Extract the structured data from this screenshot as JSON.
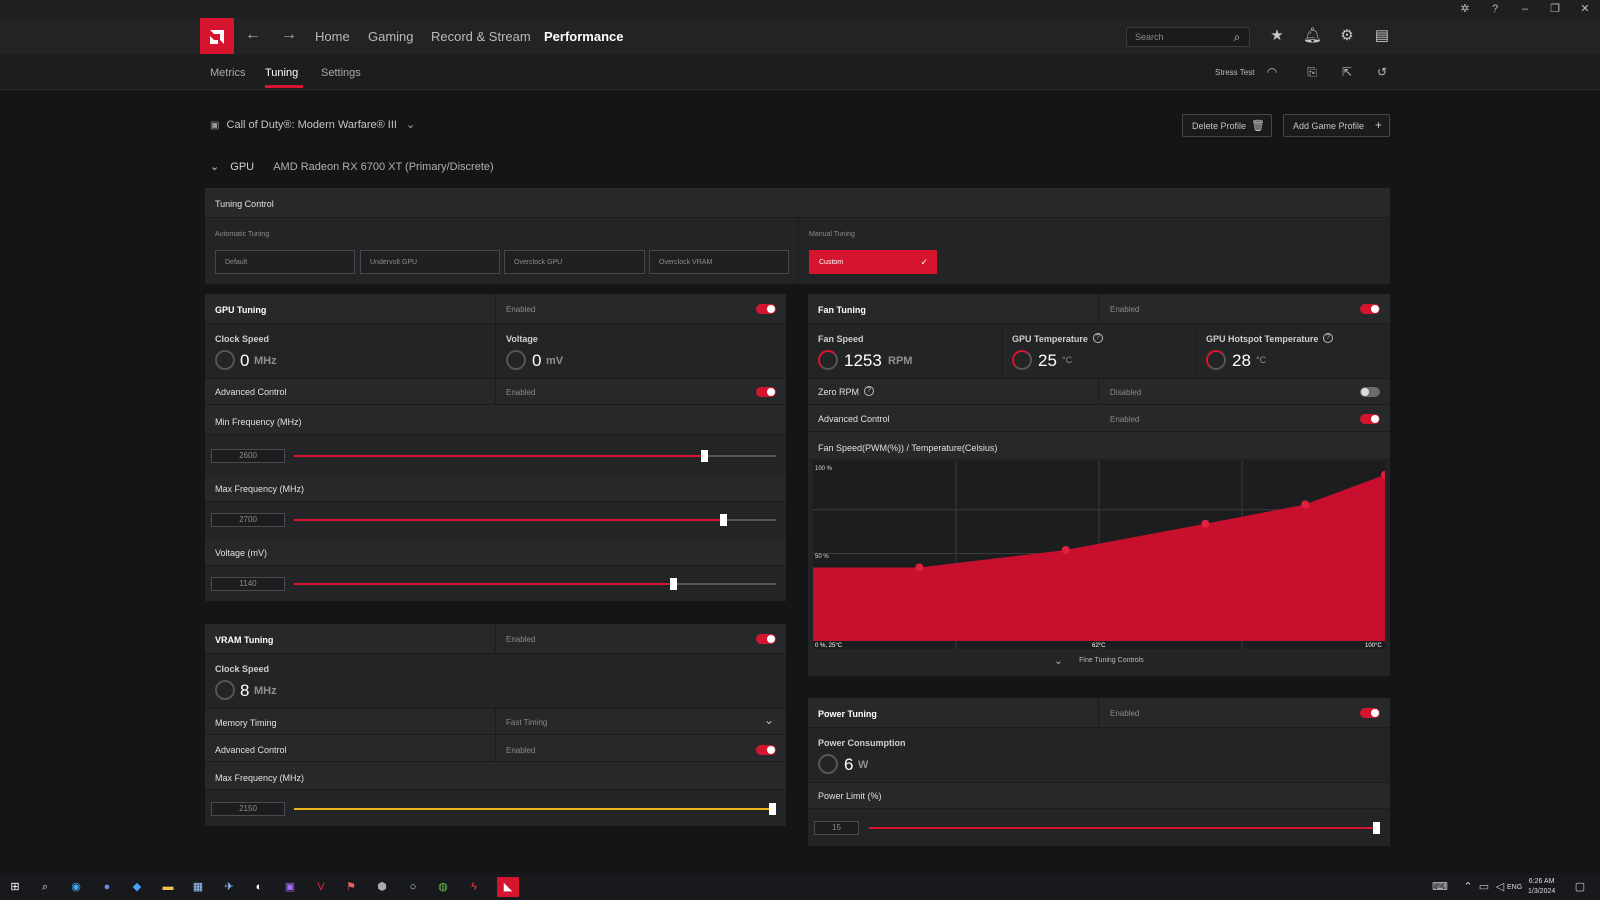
{
  "nav": {
    "items": [
      {
        "label": "Home"
      },
      {
        "label": "Gaming"
      },
      {
        "label": "Record & Stream"
      },
      {
        "label": "Performance"
      }
    ],
    "search_placeholder": "Search"
  },
  "subnav": {
    "tabs": [
      {
        "label": "Metrics"
      },
      {
        "label": "Tuning"
      },
      {
        "label": "Settings"
      }
    ],
    "stress_test": "Stress Test"
  },
  "profile": {
    "game": "Call of Duty®: Modern Warfare® III",
    "delete_label": "Delete Profile",
    "add_label": "Add Game Profile"
  },
  "gpu": {
    "label": "GPU",
    "name": "AMD Radeon RX 6700 XT (Primary/Discrete)"
  },
  "tuning_control": {
    "title": "Tuning Control",
    "auto_label": "Automatic Tuning",
    "auto_buttons": [
      "Default",
      "Undervolt GPU",
      "Overclock GPU",
      "Overclock VRAM"
    ],
    "manual_label": "Manual Tuning",
    "manual_button": "Custom"
  },
  "gpu_tuning": {
    "title": "GPU Tuning",
    "status": "Enabled",
    "clock_label": "Clock Speed",
    "clock_value": "0",
    "clock_unit": "MHz",
    "voltage_label": "Voltage",
    "voltage_value": "0",
    "voltage_unit": "mV",
    "adv_label": "Advanced Control",
    "adv_status": "Enabled",
    "min_freq_label": "Min Frequency (MHz)",
    "min_freq_value": "2600",
    "max_freq_label": "Max Frequency (MHz)",
    "max_freq_value": "2700",
    "volt_label": "Voltage (mV)",
    "volt_value": "1140"
  },
  "vram_tuning": {
    "title": "VRAM Tuning",
    "status": "Enabled",
    "clock_label": "Clock Speed",
    "clock_value": "8",
    "clock_unit": "MHz",
    "timing_label": "Memory Timing",
    "timing_value": "Fast Timing",
    "adv_label": "Advanced Control",
    "adv_status": "Enabled",
    "max_freq_label": "Max Frequency (MHz)",
    "max_freq_value": "2150"
  },
  "fan_tuning": {
    "title": "Fan Tuning",
    "status": "Enabled",
    "fan_label": "Fan Speed",
    "fan_value": "1253",
    "fan_unit": "RPM",
    "temp_label": "GPU Temperature",
    "temp_value": "25",
    "temp_unit": "°C",
    "hot_label": "GPU Hotspot Temperature",
    "hot_value": "28",
    "hot_unit": "°C",
    "zero_label": "Zero RPM",
    "zero_status": "Disabled",
    "adv_label": "Advanced Control",
    "adv_status": "Enabled",
    "curve_title": "Fan Speed(PWM(%)) / Temperature(Celsius)",
    "fine_tuning": "Fine Tuning Controls"
  },
  "chart_data": {
    "type": "area",
    "title": "Fan Speed(PWM(%)) / Temperature(Celsius)",
    "y_ticks": [
      "100 %",
      "50 %"
    ],
    "x_ticks": [
      "0 %, 25°C",
      "62°C",
      "100°C"
    ],
    "color": "#c8102e",
    "x": [
      25,
      41,
      63,
      84,
      99,
      111
    ],
    "y": [
      42,
      42,
      52,
      67,
      78,
      95
    ]
  },
  "power_tuning": {
    "title": "Power Tuning",
    "status": "Enabled",
    "consumption_label": "Power Consumption",
    "consumption_value": "6",
    "consumption_unit": "W",
    "limit_label": "Power Limit (%)",
    "limit_value": "15"
  },
  "taskbar": {
    "time": "6:26 AM",
    "date": "1/3/2024",
    "lang": "ENG"
  },
  "colors": {
    "accent": "#d5152f",
    "vram_slider": "#e8b51c"
  }
}
